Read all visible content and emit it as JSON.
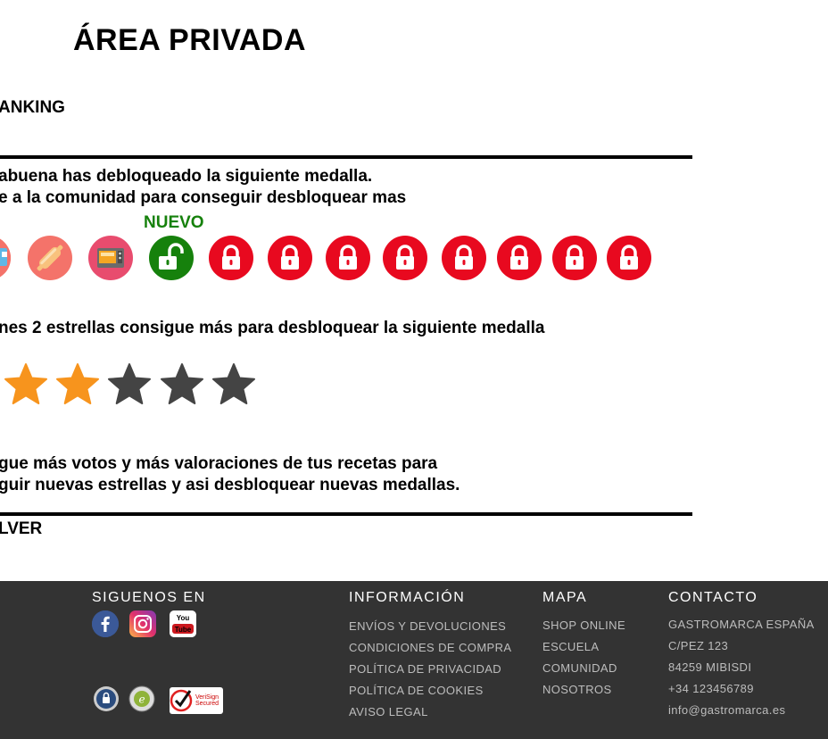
{
  "page": {
    "title": "ÁREA PRIVADA",
    "ranking_label": "ANKING",
    "medal_message": {
      "line1": "abuena has debloqueado la siguiente medalla.",
      "line2": "e a la comunidad para conseguir desbloquear mas"
    },
    "new_badge": "NUEVO",
    "stars_message": "nes 2 estrellas consigue más para desbloquear la siguiente medalla",
    "stars": {
      "filled": 2,
      "total": 5
    },
    "votes_message": {
      "line1": "gue más votos y más valoraciones de tus recetas para",
      "line2": "guir nuevas estrellas y asi desbloquear nuevas medallas."
    },
    "back_label": "LVER"
  },
  "medals": [
    {
      "name": "medal-partial-icon",
      "state": "unlocked"
    },
    {
      "name": "rolling-pin-icon",
      "state": "unlocked"
    },
    {
      "name": "oven-icon",
      "state": "unlocked"
    },
    {
      "name": "unlocked-padlock-icon",
      "state": "new"
    },
    {
      "name": "padlock-icon",
      "state": "locked"
    },
    {
      "name": "padlock-icon",
      "state": "locked"
    },
    {
      "name": "padlock-icon",
      "state": "locked"
    },
    {
      "name": "padlock-icon",
      "state": "locked"
    },
    {
      "name": "padlock-icon",
      "state": "locked"
    },
    {
      "name": "padlock-icon",
      "state": "locked"
    },
    {
      "name": "padlock-icon",
      "state": "locked"
    },
    {
      "name": "padlock-icon",
      "state": "locked"
    }
  ],
  "footer": {
    "follow": {
      "heading": "SIGUENOS EN",
      "networks": [
        "facebook-icon",
        "instagram-icon",
        "youtube-icon"
      ],
      "youtube_text": "You Tube",
      "badges": [
        "secure-seal-icon",
        "trusted-seal-icon",
        "verisign-secured-icon"
      ],
      "verisign_text": "VeriSign Secured"
    },
    "info": {
      "heading": "INFORMACIÓN",
      "links": [
        "ENVÍOS Y DEVOLUCIONES",
        "CONDICIONES DE COMPRA",
        "POLÍTICA DE PRIVACIDAD",
        "POLÍTICA DE COOKIES",
        "AVISO LEGAL"
      ]
    },
    "map": {
      "heading": "MAPA",
      "links": [
        "SHOP ONLINE",
        "ESCUELA",
        "COMUNIDAD",
        "NOSOTROS"
      ]
    },
    "contact": {
      "heading": "CONTACTO",
      "lines": [
        "GASTROMARCA ESPAÑA",
        "C/PEZ 123",
        "84259 MIBISDI",
        "+34 123456789",
        "info@gastromarca.es"
      ]
    }
  },
  "colors": {
    "lock_red": "#e8091f",
    "new_green": "#16810c",
    "star_filled": "#f7941d",
    "star_empty": "#444444",
    "footer_bg": "#333333"
  }
}
